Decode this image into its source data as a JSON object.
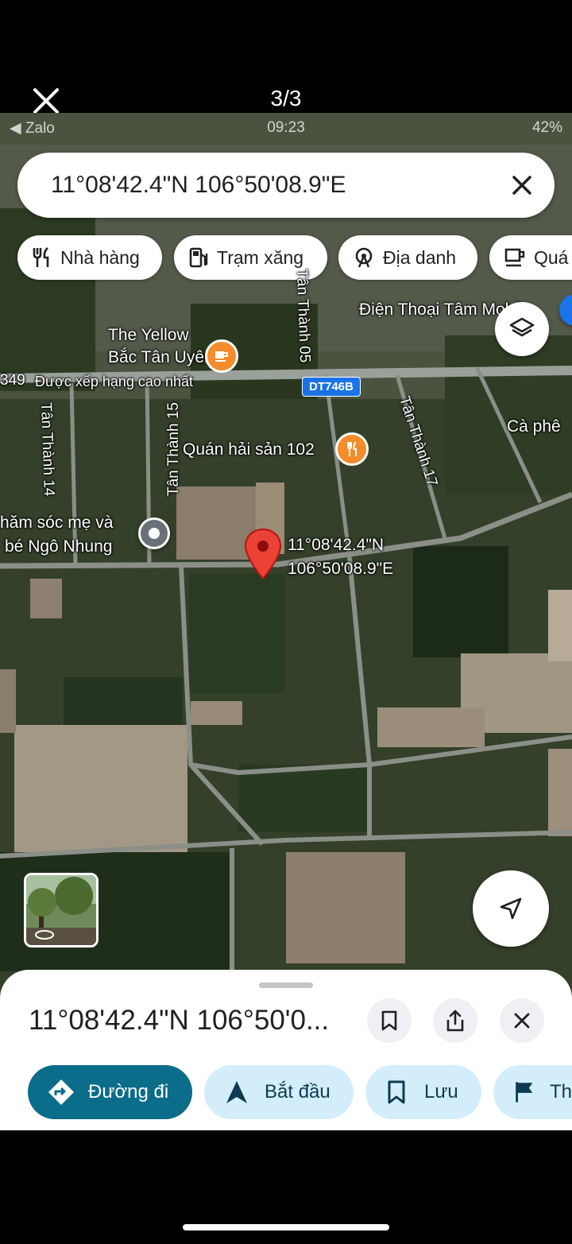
{
  "viewer": {
    "counter": "3/3",
    "close_icon": "close-icon"
  },
  "status_bar": {
    "carrier": "◀ Zalo",
    "time": "09:23",
    "battery": "42%"
  },
  "search": {
    "query": "11°08'42.4\"N 106°50'08.9\"E"
  },
  "chips": [
    {
      "label": "Nhà hàng",
      "icon": "restaurant-icon"
    },
    {
      "label": "Trạm xăng",
      "icon": "gas-station-icon"
    },
    {
      "label": "Địa danh",
      "icon": "landmark-icon"
    },
    {
      "label": "Quá",
      "icon": "coffee-icon"
    }
  ],
  "map_labels": {
    "shop": "Điện Thoại Tâm Mobile",
    "cafe_line1": "The Yellow",
    "cafe_line2": "Bắc Tân Uyên",
    "top_rated": "Được xếp hạng cao nhất",
    "road_349": "349",
    "route_shield": "DT746B",
    "tan_thanh_14": "Tân Thành 14",
    "tan_thanh_15": "Tân Thành 15",
    "tan_thanh_05": "Tân Thành 05",
    "tan_thanh_17": "Tân Thành 17",
    "ca_phe": "Cà phê",
    "seafood": "Quán hải sản 102",
    "mother_baby_line1": "hăm sóc mẹ và",
    "mother_baby_line2": "bé Ngô Nhung",
    "pin_lat": "11°08'42.4\"N",
    "pin_lon": "106°50'08.9\"E"
  },
  "sheet": {
    "title": "11°08'42.4\"N 106°50'0...",
    "actions": [
      {
        "label": "Đường đi",
        "icon": "directions-icon"
      },
      {
        "label": "Bắt đầu",
        "icon": "navigate-arrow-icon"
      },
      {
        "label": "Lưu",
        "icon": "bookmark-icon"
      },
      {
        "label": "Th",
        "icon": "flag-icon"
      }
    ]
  },
  "colors": {
    "primary": "#0b6d8a",
    "secondary_bg": "#d3eefa",
    "pin": "#ea4335",
    "poi": "#f48c2c",
    "route": "#1a73e8"
  }
}
